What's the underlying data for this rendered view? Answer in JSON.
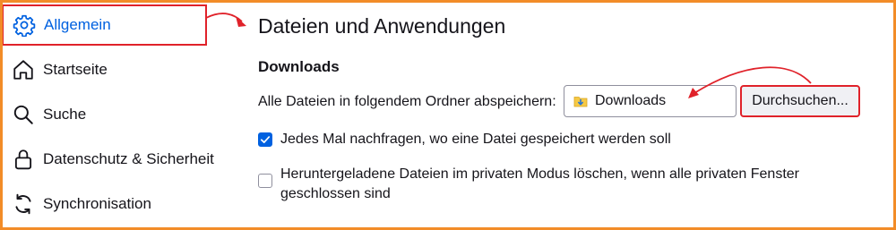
{
  "sidebar": {
    "items": [
      {
        "label": "Allgemein",
        "icon": "gear-icon",
        "active": true
      },
      {
        "label": "Startseite",
        "icon": "home-icon",
        "active": false
      },
      {
        "label": "Suche",
        "icon": "search-icon",
        "active": false
      },
      {
        "label": "Datenschutz & Sicherheit",
        "icon": "lock-icon",
        "active": false
      },
      {
        "label": "Synchronisation",
        "icon": "sync-icon",
        "active": false
      }
    ]
  },
  "main": {
    "title": "Dateien und Anwendungen",
    "section": "Downloads",
    "save_label": "Alle Dateien in folgendem Ordner abspeichern:",
    "folder_value": "Downloads",
    "browse_label": "Durchsuchen...",
    "ask_label": "Jedes Mal nachfragen, wo eine Datei gespeichert werden soll",
    "ask_checked": true,
    "delete_label": "Heruntergeladene Dateien im privaten Modus löschen, wenn alle privaten Fenster geschlossen sind",
    "delete_checked": false
  },
  "colors": {
    "accent": "#0061e0",
    "annotation": "#e0222a",
    "frame": "#f28c28"
  }
}
